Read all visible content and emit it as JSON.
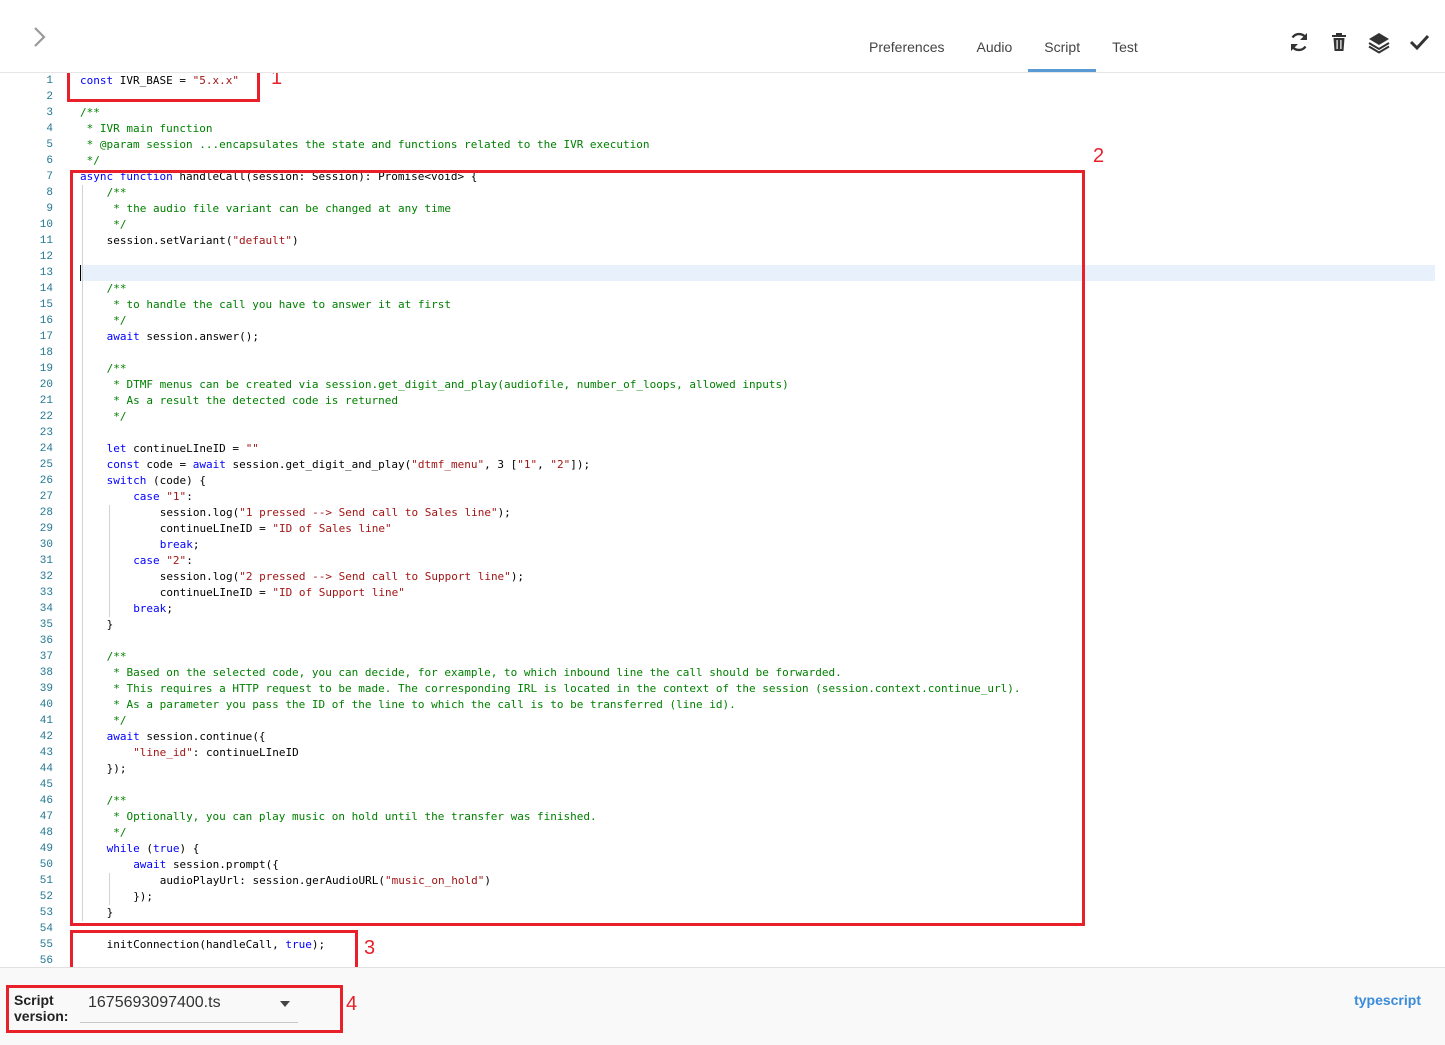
{
  "tabs": [
    {
      "label": "Preferences",
      "active": false
    },
    {
      "label": "Audio",
      "active": false
    },
    {
      "label": "Script",
      "active": true
    },
    {
      "label": "Test",
      "active": false
    }
  ],
  "toolbar": {
    "icons": [
      "refresh-icon",
      "trash-icon",
      "layers-icon",
      "check-icon"
    ]
  },
  "colors": {
    "keyword": "#0000ff",
    "string": "#a31515",
    "comment": "#008000",
    "accent": "#5b9bd5",
    "annotation": "#e8202a"
  },
  "editor": {
    "cursor_line": 13,
    "lines": [
      {
        "n": 1,
        "indent": 0,
        "t": "const IVR_BASE = \"5.x.x\""
      },
      {
        "n": 2,
        "indent": 0,
        "t": ""
      },
      {
        "n": 3,
        "indent": 0,
        "t": "/**"
      },
      {
        "n": 4,
        "indent": 0,
        "t": " * IVR main function"
      },
      {
        "n": 5,
        "indent": 0,
        "t": " * @param session ...encapsulates the state and functions related to the IVR execution"
      },
      {
        "n": 6,
        "indent": 0,
        "t": " */"
      },
      {
        "n": 7,
        "indent": 0,
        "t": "async function handleCall(session: Session): Promise<void> {"
      },
      {
        "n": 8,
        "indent": 1,
        "t": "/**"
      },
      {
        "n": 9,
        "indent": 1,
        "t": " * the audio file variant can be changed at any time"
      },
      {
        "n": 10,
        "indent": 1,
        "t": " */"
      },
      {
        "n": 11,
        "indent": 1,
        "t": "session.setVariant(\"default\")"
      },
      {
        "n": 12,
        "indent": 0,
        "t": ""
      },
      {
        "n": 13,
        "indent": 0,
        "t": ""
      },
      {
        "n": 14,
        "indent": 1,
        "t": "/**"
      },
      {
        "n": 15,
        "indent": 1,
        "t": " * to handle the call you have to answer it at first"
      },
      {
        "n": 16,
        "indent": 1,
        "t": " */"
      },
      {
        "n": 17,
        "indent": 1,
        "t": "await session.answer();"
      },
      {
        "n": 18,
        "indent": 0,
        "t": ""
      },
      {
        "n": 19,
        "indent": 1,
        "t": "/**"
      },
      {
        "n": 20,
        "indent": 1,
        "t": " * DTMF menus can be created via session.get_digit_and_play(audiofile, number_of_loops, allowed inputs)"
      },
      {
        "n": 21,
        "indent": 1,
        "t": " * As a result the detected code is returned"
      },
      {
        "n": 22,
        "indent": 1,
        "t": " */"
      },
      {
        "n": 23,
        "indent": 0,
        "t": ""
      },
      {
        "n": 24,
        "indent": 1,
        "t": "let continueLIneID = \"\""
      },
      {
        "n": 25,
        "indent": 1,
        "t": "const code = await session.get_digit_and_play(\"dtmf_menu\", 3 [\"1\", \"2\"]);"
      },
      {
        "n": 26,
        "indent": 1,
        "t": "switch (code) {"
      },
      {
        "n": 27,
        "indent": 2,
        "t": "case \"1\":"
      },
      {
        "n": 28,
        "indent": 3,
        "t": "session.log(\"1 pressed --> Send call to Sales line\");"
      },
      {
        "n": 29,
        "indent": 3,
        "t": "continueLIneID = \"ID of Sales line\""
      },
      {
        "n": 30,
        "indent": 3,
        "t": "break;"
      },
      {
        "n": 31,
        "indent": 2,
        "t": "case \"2\":"
      },
      {
        "n": 32,
        "indent": 3,
        "t": "session.log(\"2 pressed --> Send call to Support line\");"
      },
      {
        "n": 33,
        "indent": 3,
        "t": "continueLIneID = \"ID of Support line\""
      },
      {
        "n": 34,
        "indent": 2,
        "t": "break;"
      },
      {
        "n": 35,
        "indent": 1,
        "t": "}"
      },
      {
        "n": 36,
        "indent": 0,
        "t": ""
      },
      {
        "n": 37,
        "indent": 1,
        "t": "/**"
      },
      {
        "n": 38,
        "indent": 1,
        "t": " * Based on the selected code, you can decide, for example, to which inbound line the call should be forwarded."
      },
      {
        "n": 39,
        "indent": 1,
        "t": " * This requires a HTTP request to be made. The corresponding IRL is located in the context of the session (session.context.continue_url)."
      },
      {
        "n": 40,
        "indent": 1,
        "t": " * As a parameter you pass the ID of the line to which the call is to be transferred (line id)."
      },
      {
        "n": 41,
        "indent": 1,
        "t": " */"
      },
      {
        "n": 42,
        "indent": 1,
        "t": "await session.continue({"
      },
      {
        "n": 43,
        "indent": 2,
        "t": "\"line_id\": continueLIneID"
      },
      {
        "n": 44,
        "indent": 1,
        "t": "});"
      },
      {
        "n": 45,
        "indent": 0,
        "t": ""
      },
      {
        "n": 46,
        "indent": 1,
        "t": "/**"
      },
      {
        "n": 47,
        "indent": 1,
        "t": " * Optionally, you can play music on hold until the transfer was finished."
      },
      {
        "n": 48,
        "indent": 1,
        "t": " */"
      },
      {
        "n": 49,
        "indent": 1,
        "t": "while (true) {"
      },
      {
        "n": 50,
        "indent": 2,
        "t": "await session.prompt({"
      },
      {
        "n": 51,
        "indent": 3,
        "t": "audioPlayUrl: session.gerAudioURL(\"music_on_hold\")"
      },
      {
        "n": 52,
        "indent": 2,
        "t": "});"
      },
      {
        "n": 53,
        "indent": 1,
        "t": "}"
      },
      {
        "n": 54,
        "indent": 0,
        "t": ""
      },
      {
        "n": 55,
        "indent": 1,
        "t": "initConnection(handleCall, true);"
      },
      {
        "n": 56,
        "indent": 0,
        "t": ""
      }
    ]
  },
  "annotations": [
    {
      "label": "1"
    },
    {
      "label": "2"
    },
    {
      "label": "3"
    },
    {
      "label": "4"
    }
  ],
  "footer": {
    "script_version_label_1": "Script",
    "script_version_label_2": "version:",
    "script_version_value": "1675693097400.ts",
    "language": "typescript"
  }
}
